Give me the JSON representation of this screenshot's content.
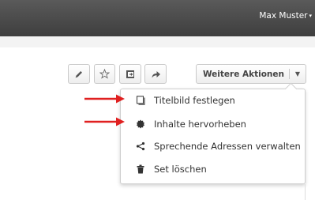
{
  "header": {
    "user_name": "Max Muster",
    "user_caret": "▾"
  },
  "toolbar": {
    "buttons": [
      {
        "icon": "pencil-icon"
      },
      {
        "icon": "star-icon"
      },
      {
        "icon": "export-icon"
      },
      {
        "icon": "share-arrow-icon"
      }
    ],
    "more_actions_label": "Weitere Aktionen",
    "more_actions_caret": "▼"
  },
  "dropdown": {
    "items": [
      {
        "label": "Titelbild festlegen",
        "icon": "cover-image-icon"
      },
      {
        "label": "Inhalte hervorheben",
        "icon": "badge-icon"
      },
      {
        "label": "Sprechende Adressen verwalten",
        "icon": "share-nodes-icon"
      },
      {
        "label": "Set löschen",
        "icon": "trash-icon"
      }
    ]
  },
  "annotations": {
    "arrow_color": "#e02020"
  },
  "colors": {
    "topbar": "#4a4a4a",
    "icon": "#555555"
  }
}
